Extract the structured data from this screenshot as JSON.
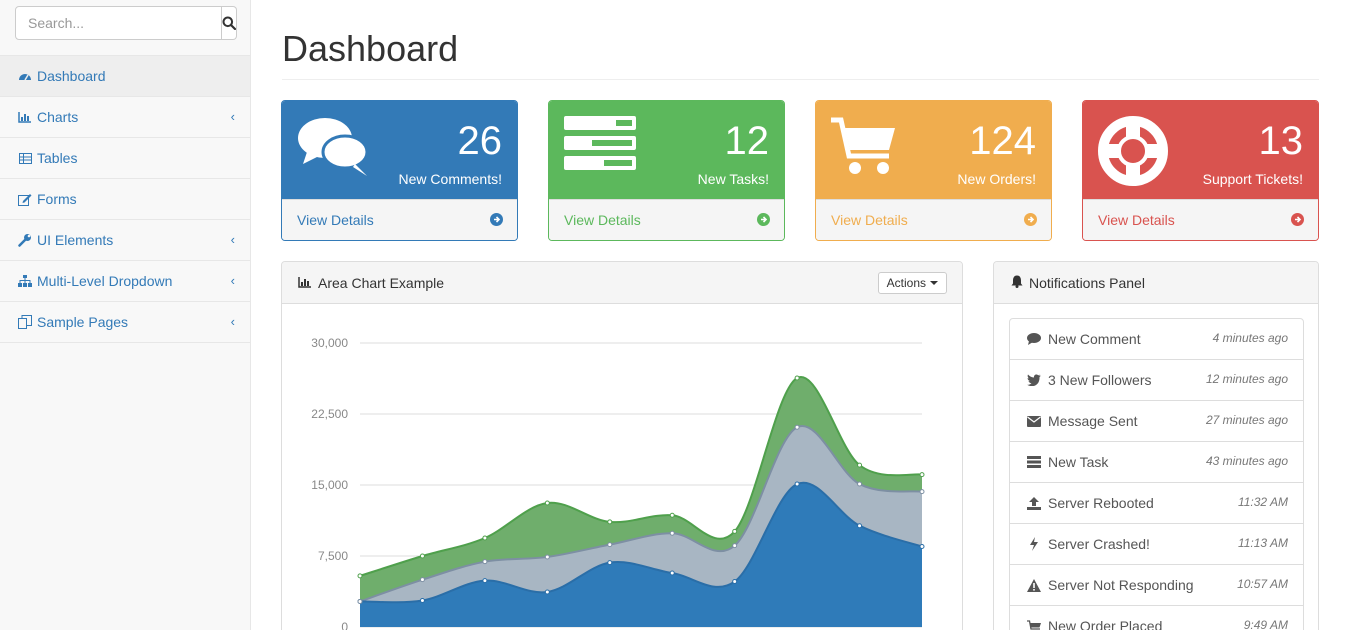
{
  "search": {
    "placeholder": "Search..."
  },
  "sidebar": {
    "items": [
      {
        "label": "Dashboard",
        "icon": "dashboard-icon"
      },
      {
        "label": "Charts",
        "icon": "bar-chart-icon"
      },
      {
        "label": "Tables",
        "icon": "table-icon"
      },
      {
        "label": "Forms",
        "icon": "edit-icon"
      },
      {
        "label": "UI Elements",
        "icon": "wrench-icon"
      },
      {
        "label": "Multi-Level Dropdown",
        "icon": "sitemap-icon"
      },
      {
        "label": "Sample Pages",
        "icon": "files-icon"
      }
    ]
  },
  "page": {
    "title": "Dashboard"
  },
  "stats": [
    {
      "value": "26",
      "label": "New Comments!",
      "details": "View Details",
      "color": "#337ab7",
      "icon": "comments-icon"
    },
    {
      "value": "12",
      "label": "New Tasks!",
      "details": "View Details",
      "color": "#5cb85c",
      "icon": "tasks-icon"
    },
    {
      "value": "124",
      "label": "New Orders!",
      "details": "View Details",
      "color": "#f0ad4e",
      "icon": "shopping-cart-icon"
    },
    {
      "value": "13",
      "label": "Support Tickets!",
      "details": "View Details",
      "color": "#d9534f",
      "icon": "support-icon"
    }
  ],
  "chart_panel": {
    "title": "Area Chart Example",
    "actions_label": "Actions"
  },
  "chart_data": {
    "type": "area",
    "stacked": true,
    "x": [
      0,
      1,
      2,
      3,
      4,
      5,
      6,
      7,
      8,
      9
    ],
    "series": [
      {
        "values": [
          2700,
          2800,
          4900,
          3700,
          6800,
          5700,
          4800,
          15100,
          10700,
          8500
        ],
        "color": "#2f7bb9"
      },
      {
        "values": [
          0,
          2200,
          2000,
          3700,
          1900,
          4200,
          3800,
          6000,
          4400,
          5800
        ],
        "color": "#a8b6c3"
      },
      {
        "values": [
          2700,
          2500,
          2500,
          5700,
          2400,
          1900,
          1500,
          5200,
          2000,
          1800
        ],
        "color": "#6fae6c"
      }
    ],
    "yticks": [
      "30,000",
      "22,500",
      "15,000",
      "7,500",
      "0"
    ],
    "ylim": [
      0,
      30000
    ],
    "grid": true
  },
  "notifications": {
    "title": "Notifications Panel",
    "items": [
      {
        "label": "New Comment",
        "time": "4 minutes ago",
        "icon": "comment-icon"
      },
      {
        "label": "3 New Followers",
        "time": "12 minutes ago",
        "icon": "twitter-icon"
      },
      {
        "label": "Message Sent",
        "time": "27 minutes ago",
        "icon": "envelope-icon"
      },
      {
        "label": "New Task",
        "time": "43 minutes ago",
        "icon": "tasks-icon"
      },
      {
        "label": "Server Rebooted",
        "time": "11:32 AM",
        "icon": "upload-icon"
      },
      {
        "label": "Server Crashed!",
        "time": "11:13 AM",
        "icon": "bolt-icon"
      },
      {
        "label": "Server Not Responding",
        "time": "10:57 AM",
        "icon": "warning-icon"
      },
      {
        "label": "New Order Placed",
        "time": "9:49 AM",
        "icon": "shopping-cart-icon"
      }
    ]
  }
}
